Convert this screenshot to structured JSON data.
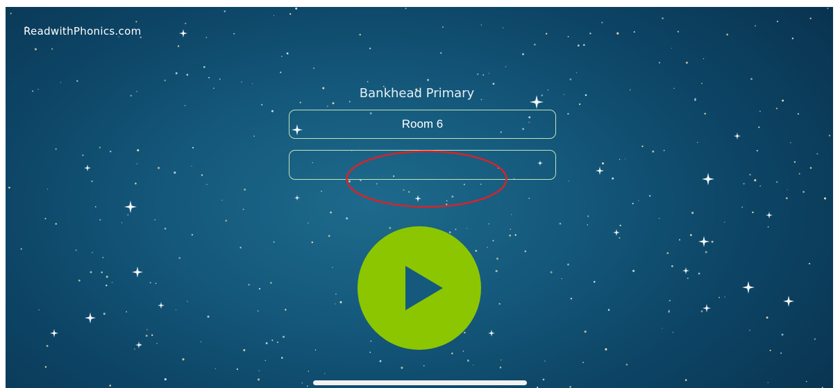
{
  "app": {
    "brand_label": "ReadwithPhonics.com"
  },
  "login": {
    "school_name": "Bankhead Primary",
    "class_value": "Room 6",
    "pin_value": "",
    "play_icon": "play-icon"
  },
  "colors": {
    "sky_center": "#1e6a8c",
    "sky_edge": "#082f4a",
    "field_border": "#c5e6b7",
    "play_green": "#8cc600",
    "play_triangle": "#155a7d",
    "annotation_red": "#d8232a",
    "star": "#f5e6b0"
  }
}
